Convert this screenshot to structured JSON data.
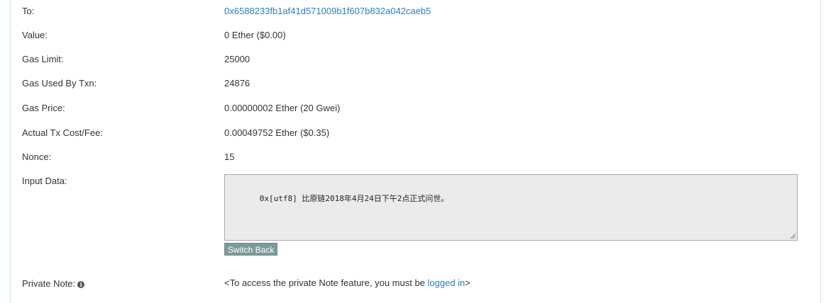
{
  "rows": {
    "to": {
      "label": "To:",
      "value": "0x6588233fb1af41d571009b1f607b832a042caeb5"
    },
    "value": {
      "label": "Value:",
      "value": "0 Ether ($0.00)"
    },
    "gas_limit": {
      "label": "Gas Limit:",
      "value": "25000"
    },
    "gas_used": {
      "label": "Gas Used By Txn:",
      "value": "24876"
    },
    "gas_price": {
      "label": "Gas Price:",
      "value": "0.00000002 Ether (20 Gwei)"
    },
    "tx_fee": {
      "label": "Actual Tx Cost/Fee:",
      "value": "0.00049752 Ether ($0.35)"
    },
    "nonce": {
      "label": "Nonce:",
      "value": "15"
    },
    "input_data": {
      "label": "Input Data:",
      "value": "0x[utf8] 比原链2018年4月24日下午2点正式问世。"
    }
  },
  "switch_back_label": "Switch Back",
  "private_note": {
    "label": "Private Note:",
    "text_before": "<To access the private Note feature, you must be ",
    "link_text": "logged in",
    "text_after": ">"
  },
  "icons": {
    "info": "info-circle-icon",
    "resize": "resize-grip-icon"
  },
  "colors": {
    "link": "#2c7fc2",
    "button_bg": "#7c9a9a",
    "panel_border": "#cfe3ee"
  }
}
